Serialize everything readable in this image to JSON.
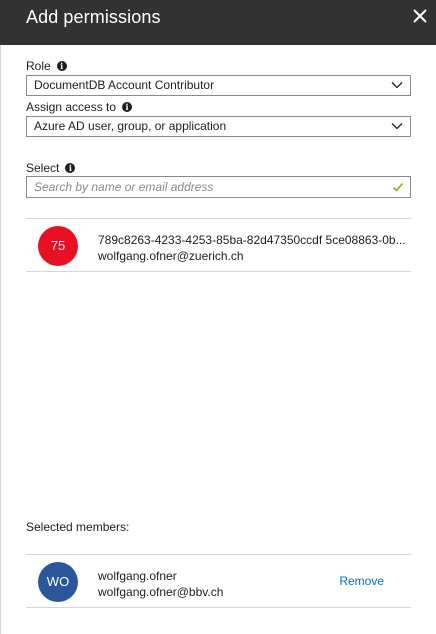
{
  "header": {
    "title": "Add permissions",
    "close_icon": "close-icon"
  },
  "role": {
    "label": "Role",
    "value": "DocumentDB Account Contributor"
  },
  "assign_access": {
    "label": "Assign access to",
    "value": "Azure AD user, group, or application"
  },
  "select": {
    "label": "Select",
    "placeholder": "Search by name or email address"
  },
  "search_result": {
    "initials": "75",
    "avatar_color": "#e81123",
    "name": "789c8263-4233-4253-85ba-82d47350ccdf 5ce08863-0b...",
    "email": "wolfgang.ofner@zuerich.ch"
  },
  "selected_members": {
    "label": "Selected members:",
    "items": [
      {
        "initials": "WO",
        "avatar_color": "#2b579a",
        "name": "wolfgang.ofner",
        "email": "wolfgang.ofner@bbv.ch",
        "action": "Remove"
      }
    ]
  },
  "colors": {
    "header_bg": "#323232",
    "link": "#0072c6",
    "check": "#7fba00"
  }
}
